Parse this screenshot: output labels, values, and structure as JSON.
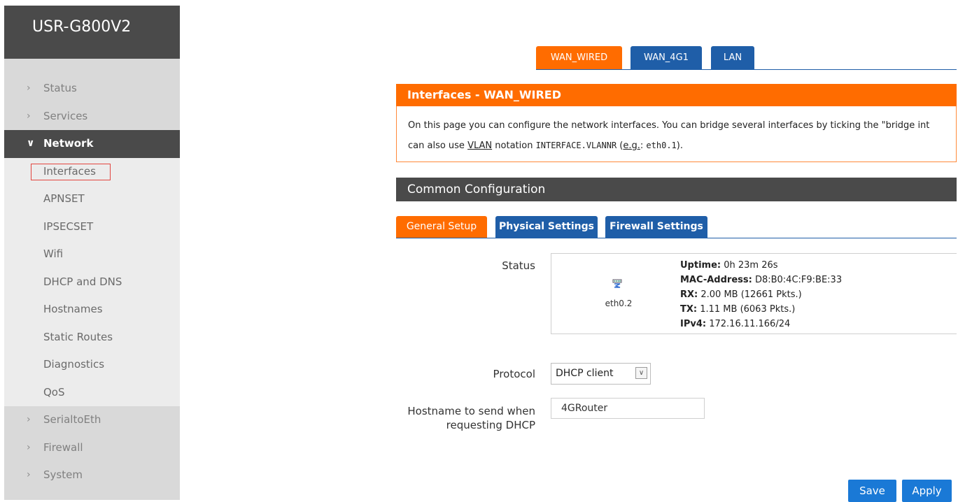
{
  "brand": "USR-G800V2",
  "sidebar": {
    "items_top": [
      {
        "label": "Status",
        "chevron": "›"
      },
      {
        "label": "Services",
        "chevron": "›"
      },
      {
        "label": "Network",
        "chevron": "∨"
      }
    ],
    "network_children": [
      {
        "label": "Interfaces"
      },
      {
        "label": "APNSET"
      },
      {
        "label": "IPSECSET"
      },
      {
        "label": "Wifi"
      },
      {
        "label": "DHCP and DNS"
      },
      {
        "label": "Hostnames"
      },
      {
        "label": "Static Routes"
      },
      {
        "label": "Diagnostics"
      },
      {
        "label": "QoS"
      }
    ],
    "items_bottom": [
      {
        "label": "SerialtoEth",
        "chevron": "›"
      },
      {
        "label": "Firewall",
        "chevron": "›"
      },
      {
        "label": "System",
        "chevron": "›"
      }
    ]
  },
  "top_tabs": [
    {
      "label": "WAN_WIRED"
    },
    {
      "label": "WAN_4G1"
    },
    {
      "label": "LAN"
    }
  ],
  "interfaces_title": "Interfaces - WAN_WIRED",
  "description": {
    "line1": "On this page you can configure the network interfaces. You can bridge several interfaces by ticking the \"bridge int",
    "line2_pre": "can also use ",
    "vlan": "VLAN",
    "line2_mid": " notation ",
    "code1": "INTERFACE.VLANNR",
    "paren_open": " (",
    "eg": "e.g.",
    "colon": ": ",
    "code2": "eth0.1",
    "paren_close": ")."
  },
  "section_title": "Common Configuration",
  "sub_tabs": [
    {
      "label": "General Setup"
    },
    {
      "label": "Physical Settings"
    },
    {
      "label": "Firewall Settings"
    }
  ],
  "status": {
    "label": "Status",
    "iface": "eth0.2",
    "uptime_key": "Uptime:",
    "uptime_val": " 0h 23m 26s",
    "mac_key": "MAC-Address:",
    "mac_val": " D8:B0:4C:F9:BE:33",
    "rx_key": "RX:",
    "rx_val": " 2.00 MB (12661 Pkts.)",
    "tx_key": "TX:",
    "tx_val": " 1.11 MB (6063 Pkts.)",
    "ipv4_key": "IPv4:",
    "ipv4_val": " 172.16.11.166/24"
  },
  "protocol": {
    "label": "Protocol",
    "value": "DHCP client",
    "arrow": "∨"
  },
  "hostname": {
    "label_line1": "Hostname to send when",
    "label_line2": "requesting DHCP",
    "value": "4GRouter"
  },
  "buttons": {
    "save": "Save",
    "apply": "Apply"
  }
}
